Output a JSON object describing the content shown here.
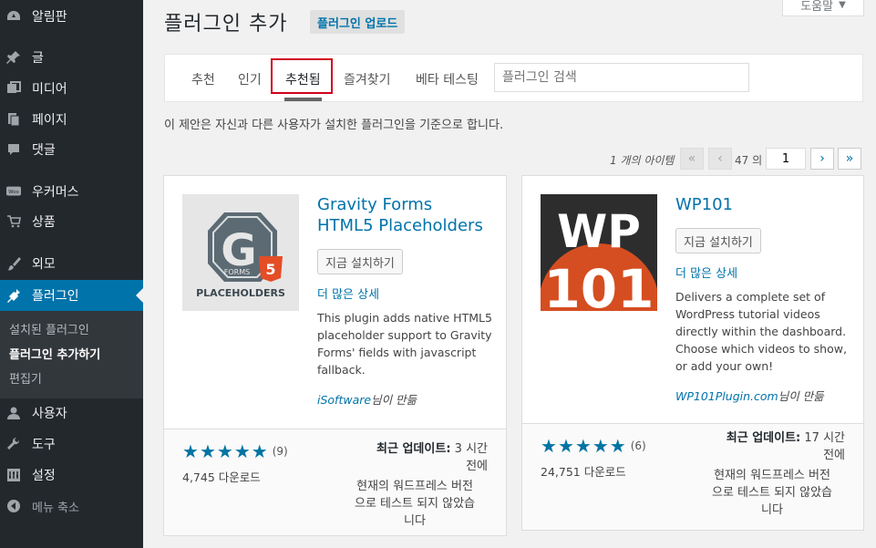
{
  "sidebar": {
    "items": [
      {
        "label": "알림판",
        "icon": "dashboard-icon"
      },
      {
        "label": "글",
        "icon": "pin-icon"
      },
      {
        "label": "미디어",
        "icon": "media-icon"
      },
      {
        "label": "페이지",
        "icon": "pages-icon"
      },
      {
        "label": "댓글",
        "icon": "comment-icon"
      },
      {
        "label": "우커머스",
        "icon": "woo-icon"
      },
      {
        "label": "상품",
        "icon": "cart-icon"
      },
      {
        "label": "외모",
        "icon": "brush-icon"
      },
      {
        "label": "플러그인",
        "icon": "plugin-icon"
      },
      {
        "label": "사용자",
        "icon": "user-icon"
      },
      {
        "label": "도구",
        "icon": "wrench-icon"
      },
      {
        "label": "설정",
        "icon": "settings-icon"
      },
      {
        "label": "메뉴 축소",
        "icon": "collapse-icon"
      }
    ],
    "submenu": [
      "설치된 플러그인",
      "플러그인 추가하기",
      "편집기"
    ]
  },
  "header": {
    "title": "플러그인 추가",
    "upload_label": "플러그인 업로드",
    "help_label": "도움말"
  },
  "filter": {
    "tabs": [
      "추천",
      "인기",
      "추천됨",
      "즐겨찾기",
      "베타 테스팅"
    ],
    "search_placeholder": "플러그인 검색"
  },
  "description": "이 제안은 자신과 다른 사용자가 설치한 플러그인을 기준으로 합니다.",
  "pagination": {
    "item_count": "1 개의 아이템",
    "first": "«",
    "prev": "‹",
    "of_total": "47 의",
    "current_page": "1",
    "next": "›",
    "last": "»"
  },
  "plugins": [
    {
      "name_line1": "Gravity Forms",
      "name_line2": "HTML5 Placeholders",
      "install_label": "지금 설치하기",
      "more_label": "더 많은 상세",
      "desc_lines": [
        "This plugin adds native HTML5",
        "placeholder support to Gravity",
        "Forms' fields with javascript",
        "fallback."
      ],
      "author_name": "iSoftware",
      "author_suffix": "님이 만듦",
      "rating_count": "(9)",
      "downloads": "4,745 다운로드",
      "updated_label": "최근 업데이트:",
      "updated_value1": "3 시간",
      "updated_value2": "전에",
      "compat_lines": [
        "현재의 워드프레스 버전",
        "으로 테스트 되지 않았습",
        "니다"
      ],
      "icon_text": "PLACEHOLDERS",
      "icon_letter": "G",
      "icon_forms": "FORMS",
      "icon_badge": "5"
    },
    {
      "name_line1": "WP101",
      "install_label": "지금 설치하기",
      "more_label": "더 많은 상세",
      "desc_lines": [
        "Delivers a complete set of",
        "WordPress tutorial videos",
        "directly within the dashboard.",
        "Choose which videos to show,",
        "or add your own!"
      ],
      "author_name": "WP101Plugin.com",
      "author_suffix": "님이 만듦",
      "rating_count": "(6)",
      "downloads": "24,751 다운로드",
      "updated_label": "최근 업데이트:",
      "updated_value1": "17 시간",
      "updated_value2": "전에",
      "compat_lines": [
        "현재의 워드프레스 버전",
        "으로 테스트 되지 않았습",
        "니다"
      ],
      "icon_top": "WP",
      "icon_bottom": "101"
    }
  ],
  "colors": {
    "sidebar_bg": "#23282d",
    "accent": "#0073aa",
    "highlight": "#d0021b",
    "wp101_orange": "#d54e21"
  }
}
